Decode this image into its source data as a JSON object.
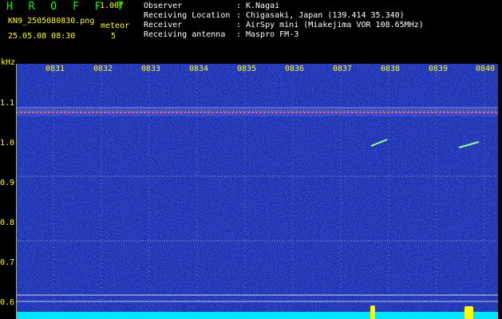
{
  "header": {
    "app_title": "H R O F F T",
    "version": "1.00f",
    "filename": "KN9_2505080830.png",
    "meteor_label": "meteor",
    "datetime": "25.05.08 08:30",
    "meteor_count": "5"
  },
  "info": [
    {
      "key": "Observer",
      "sep": ":",
      "value": "K.Nagai"
    },
    {
      "key": "Receiving Location",
      "sep": ":",
      "value": "Chigasaki, Japan (139.414 35.340)"
    },
    {
      "key": "Receiver",
      "sep": ":",
      "value": "AirSpy mini (Miakejima VOR 108.65MHz)"
    },
    {
      "key": "Receiving antenna",
      "sep": ":",
      "value": "Maspro FM-3"
    }
  ],
  "axes": {
    "y_unit": "kHz",
    "y_ticks": [
      "1.1",
      "1.0",
      "0.9",
      "0.8",
      "0.7",
      "0.6"
    ],
    "x_ticks": [
      "0831",
      "0832",
      "0833",
      "0834",
      "0835",
      "0836",
      "0837",
      "0838",
      "0839",
      "0840"
    ]
  },
  "colors": {
    "background": "#000000",
    "spectrogram": "#1b2fb2",
    "title_green": "#00ff00",
    "label_yellow": "#ffff00",
    "carrier_line": "#ff6060",
    "noise_floor": "#00e5ff"
  }
}
